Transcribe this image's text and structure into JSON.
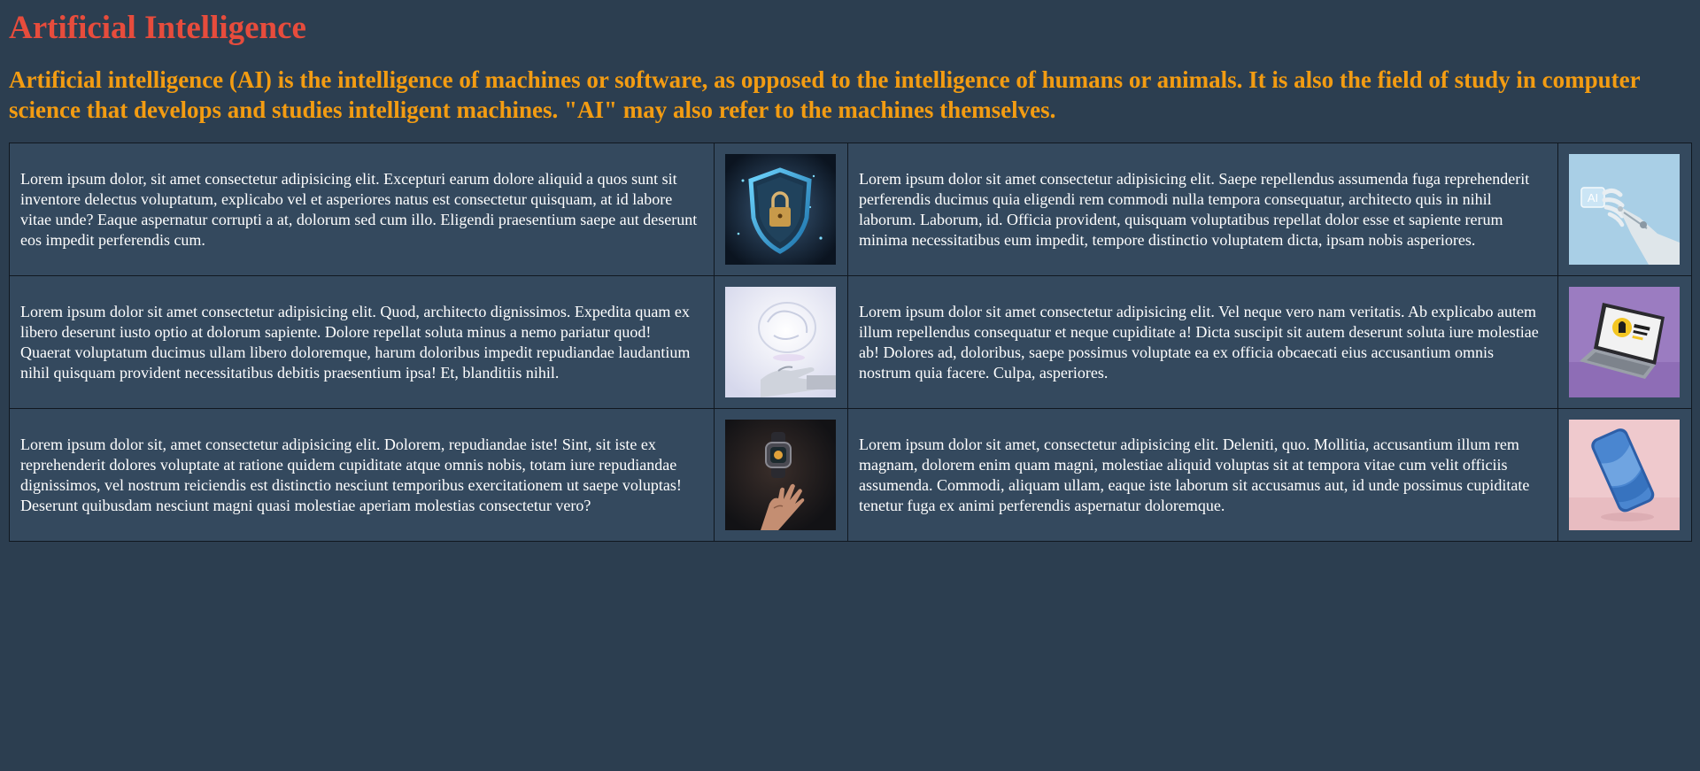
{
  "header": {
    "title": "Artificial Intelligence",
    "subtitle": "Artificial intelligence (AI) is the intelligence of machines or software, as opposed to the intelligence of humans or animals. It is also the field of study in computer science that develops and studies intelligent machines. \"AI\" may also refer to the machines themselves."
  },
  "rows": [
    {
      "left_text": "Lorem ipsum dolor, sit amet consectetur adipisicing elit. Excepturi earum dolore aliquid a quos sunt sit inventore delectus voluptatum, explicabo vel et asperiores natus est consectetur quisquam, at id labore vitae unde? Eaque aspernatur corrupti a at, dolorum sed cum illo. Eligendi praesentium saepe aut deserunt eos impedit perferendis cum.",
      "left_image": "shield-lock-image",
      "right_text": "Lorem ipsum dolor sit amet consectetur adipisicing elit. Saepe repellendus assumenda fuga reprehenderit perferendis ducimus quia eligendi rem commodi nulla tempora consequatur, architecto quis in nihil laborum. Laborum, id. Officia provident, quisquam voluptatibus repellat dolor esse et sapiente rerum minima necessitatibus eum impedit, tempore distinctio voluptatem dicta, ipsam nobis asperiores.",
      "right_image": "robot-hand-ai-image"
    },
    {
      "left_text": "Lorem ipsum dolor sit amet consectetur adipisicing elit. Quod, architecto dignissimos. Expedita quam ex libero deserunt iusto optio at dolorum sapiente. Dolore repellat soluta minus a nemo pariatur quod! Quaerat voluptatum ducimus ullam libero doloremque, harum doloribus impedit repudiandae laudantium nihil quisquam provident necessitatibus debitis praesentium ipsa! Et, blanditiis nihil.",
      "left_image": "robot-hand-brain-image",
      "right_text": "Lorem ipsum dolor sit amet consectetur adipisicing elit. Vel neque vero nam veritatis. Ab explicabo autem illum repellendus consequatur et neque cupiditate a! Dicta suscipit sit autem deserunt soluta iure molestiae ab! Dolores ad, doloribus, saepe possimus voluptate ea ex officia obcaecati eius accusantium omnis nostrum quia facere. Culpa, asperiores.",
      "right_image": "laptop-purple-image"
    },
    {
      "left_text": "Lorem ipsum dolor sit, amet consectetur adipisicing elit. Dolorem, repudiandae iste! Sint, sit iste ex reprehenderit dolores voluptate at ratione quidem cupiditate atque omnis nobis, totam iure repudiandae dignissimos, vel nostrum reiciendis est distinctio nesciunt temporibus exercitationem ut saepe voluptas! Deserunt quibusdam nesciunt magni quasi molestiae aperiam molestias consectetur vero?",
      "left_image": "hand-smartwatch-image",
      "right_text": "Lorem ipsum dolor sit amet, consectetur adipisicing elit. Deleniti, quo. Mollitia, accusantium illum rem magnam, dolorem enim quam magni, molestiae aliquid voluptas sit at tempora vitae cum velit officiis assumenda. Commodi, aliquam ullam, eaque iste laborum sit accusamus aut, id unde possimus cupiditate tenetur fuga ex animi perferendis aspernatur doloremque.",
      "right_image": "smartphone-pink-image"
    }
  ],
  "image_badges": {
    "ai_badge": "AI"
  },
  "colors": {
    "background": "#2c3e50",
    "cell_background": "#34495e",
    "title": "#e74c3c",
    "subtitle": "#f39c12",
    "text": "#ffffff"
  }
}
